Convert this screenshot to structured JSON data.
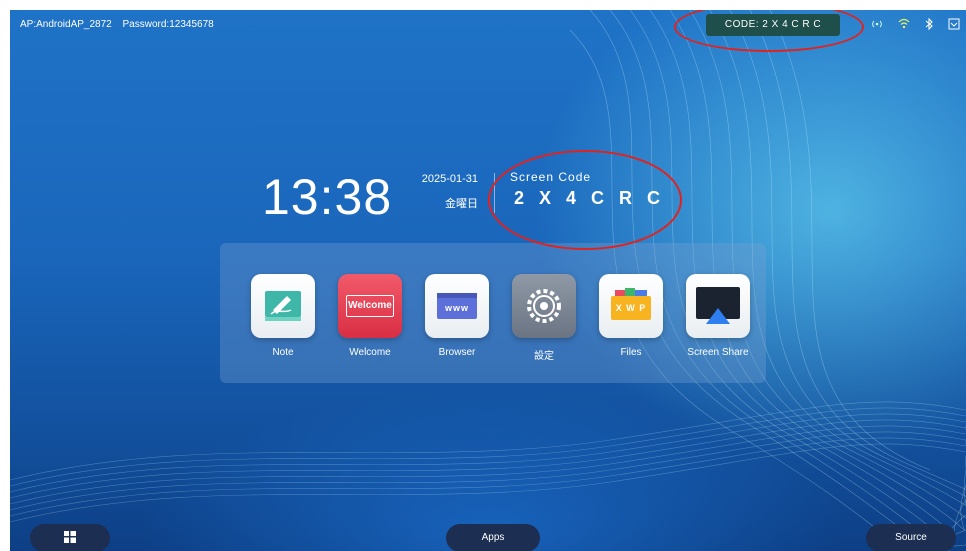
{
  "top_bar": {
    "ap_name": "AP:AndroidAP_2872",
    "password": "Password:12345678",
    "code_chip": "CODE: 2 X 4 C R C",
    "status_icons": [
      "hotspot-icon",
      "wifi-icon",
      "bluetooth-icon",
      "screen-icon"
    ]
  },
  "home": {
    "time": "13:38",
    "date": "2025-01-31",
    "weekday": "金曜日",
    "screen_code_label": "Screen Code",
    "screen_code": "2 X 4 C R C"
  },
  "dock": {
    "apps": [
      {
        "label": "Note",
        "icon": "note-icon",
        "tile_text": ""
      },
      {
        "label": "Welcome",
        "icon": "welcome-icon",
        "tile_text": "Welcome"
      },
      {
        "label": "Browser",
        "icon": "browser-icon",
        "tile_text": "www"
      },
      {
        "label": "設定",
        "icon": "settings-icon",
        "tile_text": ""
      },
      {
        "label": "Files",
        "icon": "files-icon",
        "tile_text": "X W P"
      },
      {
        "label": "Screen Share",
        "icon": "screen-share-icon",
        "tile_text": ""
      }
    ]
  },
  "bottom_bar": {
    "windows_icon": "windows-icon",
    "apps_label": "Apps",
    "source_label": "Source"
  },
  "colors": {
    "annotation_red": "#e0231f",
    "code_chip_bg": "#1f4f4a",
    "bottom_button_bg": "#1c2f52"
  }
}
